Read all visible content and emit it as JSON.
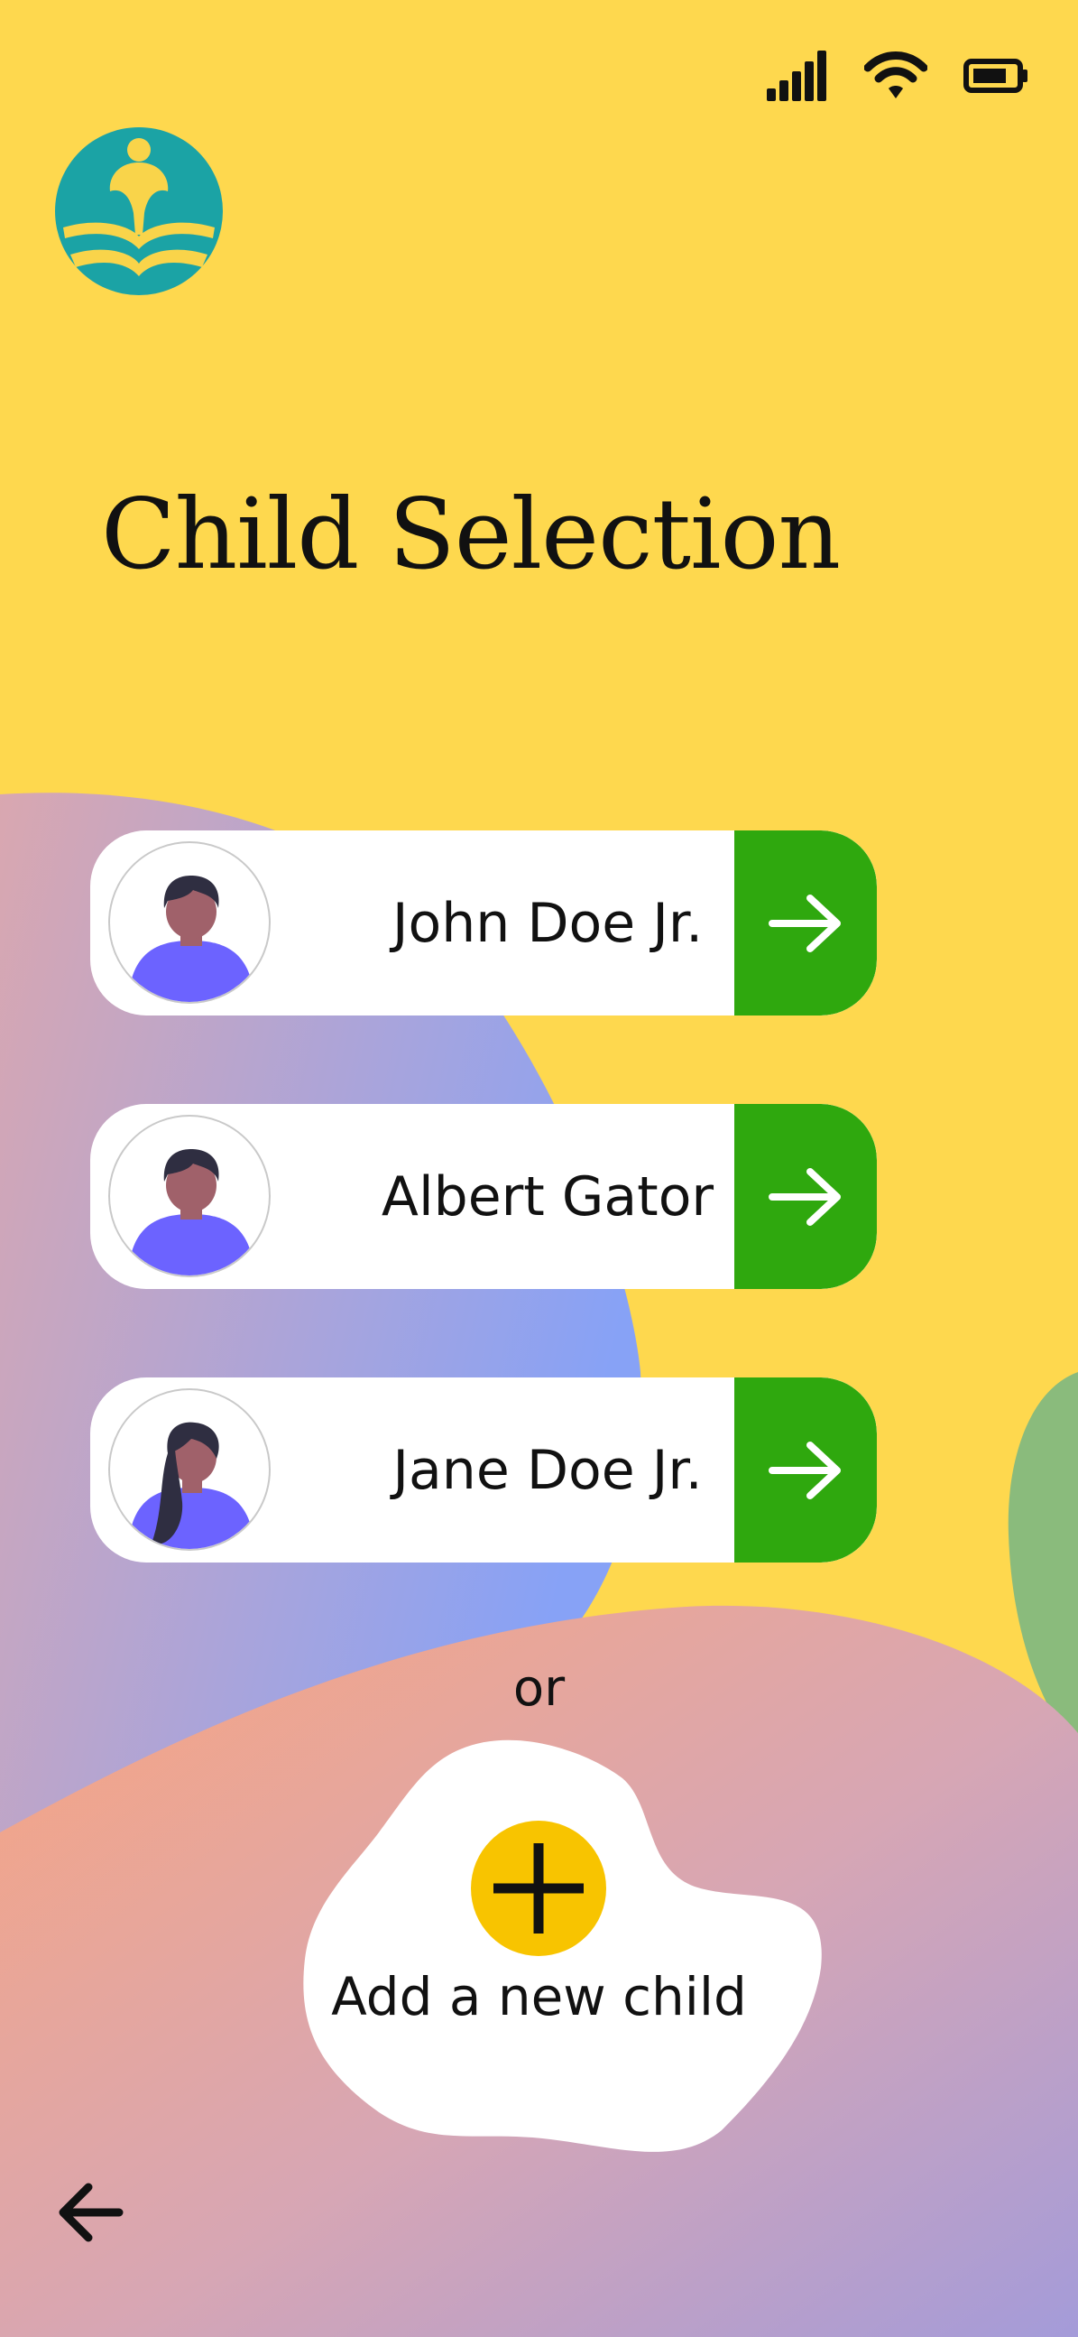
{
  "header": {
    "title": "Child Selection",
    "logo_icon": "leaf-emblem-icon"
  },
  "status_bar": {
    "icons": [
      "cellular-signal-icon",
      "wifi-icon",
      "battery-icon"
    ]
  },
  "children": [
    {
      "name": "John Doe Jr.",
      "avatar": "boy-avatar-icon",
      "action_icon": "arrow-right-icon"
    },
    {
      "name": "Albert Gator",
      "avatar": "boy-avatar-icon",
      "action_icon": "arrow-right-icon"
    },
    {
      "name": "Jane Doe Jr.",
      "avatar": "girl-avatar-icon",
      "action_icon": "arrow-right-icon"
    }
  ],
  "separator_text": "or",
  "add_child": {
    "label": "Add a new child",
    "icon": "plus-icon"
  },
  "navigation": {
    "back_icon": "arrow-left-icon"
  },
  "colors": {
    "background": "#FED84E",
    "go_button": "#2FA80E",
    "plus_circle": "#F8C400",
    "logo": "#1BA3A5",
    "avatar_shirt": "#6C63FF",
    "avatar_skin": "#A0616A"
  }
}
